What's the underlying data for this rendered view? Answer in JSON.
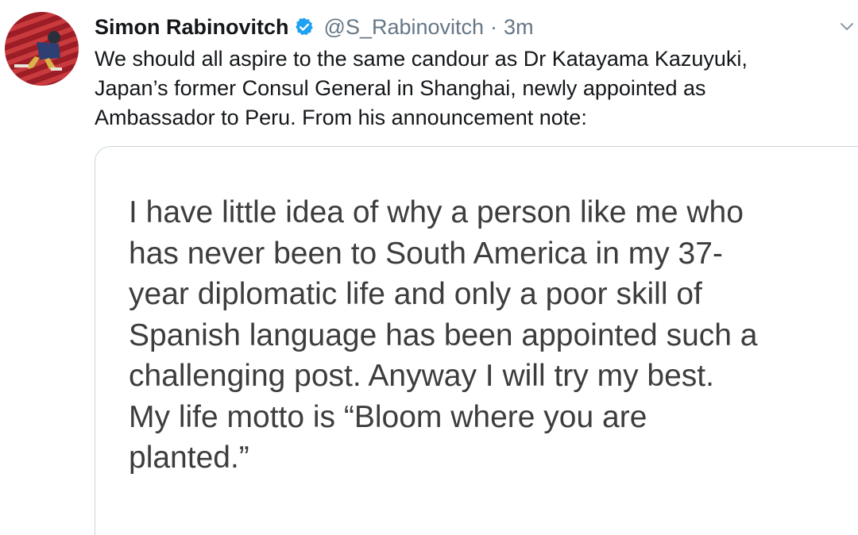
{
  "tweet": {
    "author": {
      "display_name": "Simon Rabinovitch",
      "handle": "@S_Rabinovitch",
      "verified": true,
      "avatar_icon": "avatar-photo"
    },
    "separator": "·",
    "timestamp": "3m",
    "text_lines": [
      "We should all aspire to the same candour as Dr Katayama Kazuyuki,",
      "Japan’s former Consul General in Shanghai, newly appointed as",
      "Ambassador to Peru. From his announcement note:"
    ],
    "menu_icon": "chevron-down-icon",
    "media": {
      "lines": [
        "I have little idea of why a person like me who",
        "has never been to South America in my 37-",
        "year diplomatic life and only a poor skill of",
        "Spanish language has been appointed such a",
        "challenging post. Anyway I will try my best.",
        "My life motto is “Bloom where you are",
        "planted.”"
      ]
    }
  },
  "colors": {
    "text_primary": "#14171a",
    "text_secondary": "#657786",
    "verified_blue": "#1da1f2",
    "card_border": "#ccd6dd",
    "note_text": "#3d3d3d"
  }
}
